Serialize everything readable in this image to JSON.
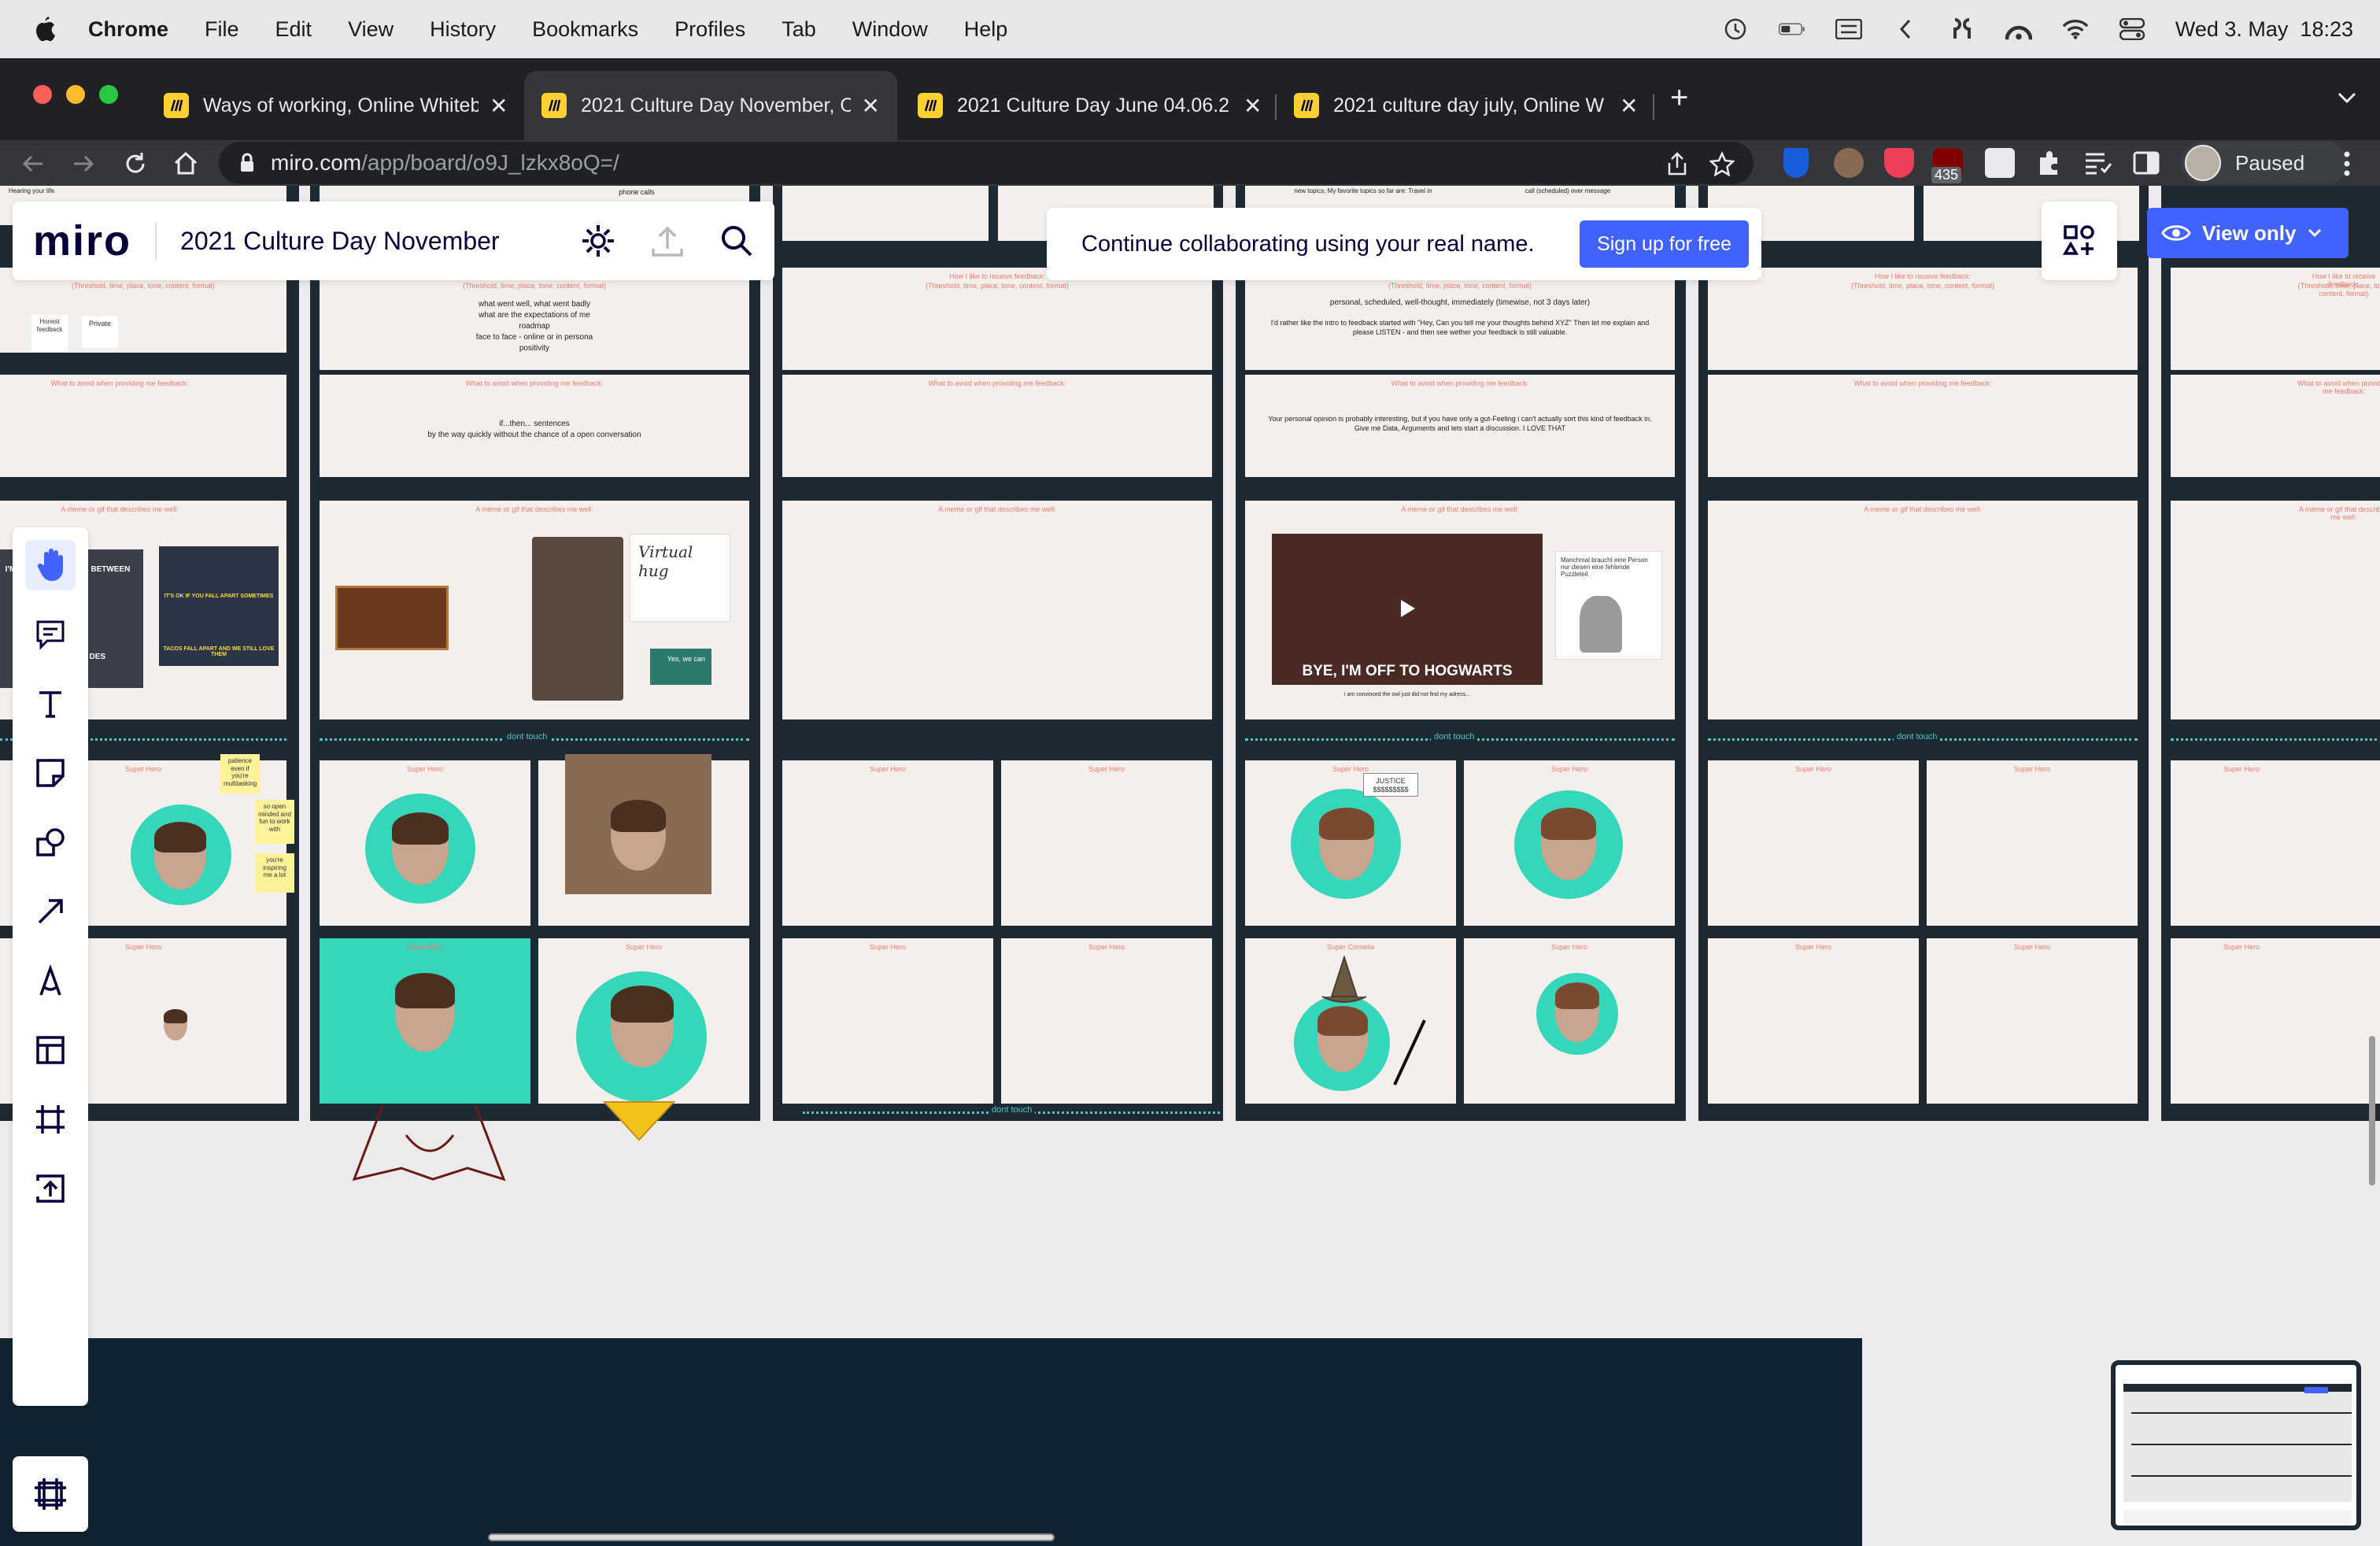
{
  "menubar": {
    "app": "Chrome",
    "items": [
      "File",
      "Edit",
      "View",
      "History",
      "Bookmarks",
      "Profiles",
      "Tab",
      "Window",
      "Help"
    ],
    "datetime": "Wed 3. May  18:23"
  },
  "tabs": [
    {
      "title": "Ways of working, Online Whiteb"
    },
    {
      "title": "2021 Culture Day November, O"
    },
    {
      "title": "2021 Culture Day June 04.06.2"
    },
    {
      "title": "2021 culture day july, Online W"
    }
  ],
  "toolbar": {
    "url_host": "miro.com",
    "url_path": "/app/board/o9J_lzkx8oQ=/",
    "badge": "435",
    "profile_label": "Paused"
  },
  "miro": {
    "logo": "miro",
    "board_title": "2021 Culture Day November",
    "collab_msg": "Continue collaborating using your real name.",
    "signup": "Sign up for free",
    "view_only": "View only"
  },
  "board": {
    "receive_title": "How I like to receive feedback:",
    "receive_sub": "(Threshold, time, place, tone, content, format)",
    "avoid_title": "What to avoid when providing me feedback:",
    "meme_title": "A meme or gif that describes me well:",
    "super_hero": "Super Hero",
    "super_cornelia": "Super Cornelia",
    "dont_touch": "dont touch",
    "col2_receive_text": [
      "what went well, what went badly",
      "what are the expectations of me",
      "roadmap",
      "face to face - online or in persona",
      "positivity"
    ],
    "col2_avoid_text": [
      "if...then... sentences",
      "by the way quickly without the chance of a open conversation"
    ],
    "col4_receive_text": [
      "personal, scheduled, well-thought, immediately (timewise, not 3 days later)",
      "I'd rather like the intro to feedback started with \"Hey, Can you tell me your thoughts behind XYZ\" Then let me explain and please LISTEN - and then see wether your feedback is still valuable."
    ],
    "col4_avoid_text": [
      "Your personal opinion is probably interesting, but if you have only a gut-Feeling i can't actually sort this kind of feedback in. Give me Data, Arguments and lets start a discussion. I LOVE THAT"
    ],
    "hogwarts_caption": "BYE, I'M OFF TO HOGWARTS",
    "hogwarts_sub": "i am convinced the owl just did not find my adress...",
    "puzzle_text": "Manchmal braucht eine Person nur diesen eine fehlende Puzzleteil.",
    "virtual_hug": "Virtual hug",
    "yes_we_can": "Yes, we can",
    "justice": "JUSTICE $$$$$$$$$",
    "col1_notes": [
      "Honest feedback",
      "Private"
    ],
    "col1_top_notes": [
      "Hearing your life"
    ],
    "col2_top": "phone calls",
    "col4_top_1": "new topics. My favorite topics so far are: Travel in",
    "col4_top_2": "call (scheduled) over message",
    "sticky_notes": [
      "patience even if you're multitasking",
      "so open minded and fun to work with",
      "you're inspiring me a lot"
    ],
    "meme1_top": "I'M HAVE TO CHOOSE BETWEEN",
    "meme1_bottom": "DIE, DAS, DER, DES",
    "meme2_top": "IT'S OK IF YOU FALL APART SOMETIMES",
    "meme2_bottom": "TACOS FALL APART AND WE STILL LOVE THEM"
  },
  "colors": {
    "accent": "#4262ff",
    "frame": "#1e2a33",
    "card": "#f4efec",
    "label": "#ec7a6e",
    "hero_bg": "#36d6bb",
    "dotted": "#49c8c4"
  }
}
